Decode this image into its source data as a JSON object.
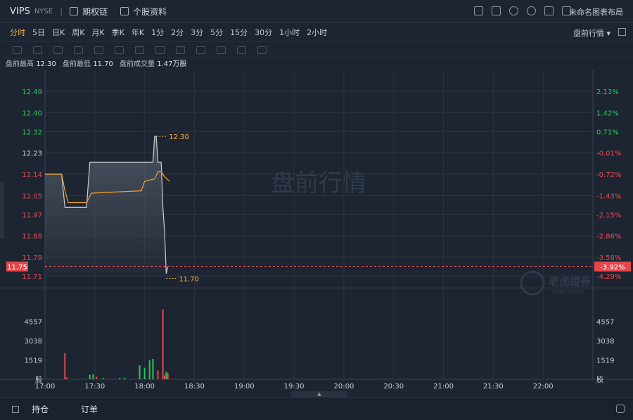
{
  "header": {
    "symbol": "VIPS",
    "exchange": "NYSE",
    "options_chain": "期权链",
    "stock_profile": "个股资料",
    "layout_name": "未命名图表布局",
    "icons": [
      "screen-icon",
      "edit-icon",
      "refresh-icon",
      "settings-icon",
      "fullscreen-icon",
      "grid-icon"
    ]
  },
  "period_tabs": [
    "分时",
    "5日",
    "日K",
    "周K",
    "月K",
    "季K",
    "年K",
    "1分",
    "2分",
    "3分",
    "5分",
    "15分",
    "30分",
    "1小时",
    "2小时"
  ],
  "active_tab": "分时",
  "premarket_mode": "盘前行情",
  "info": {
    "high_label": "盘前最高",
    "high_value": "12.30",
    "low_label": "盘前最低",
    "low_value": "11.70",
    "volume_label": "盘前成交量",
    "volume_value": "1.47万股"
  },
  "watermark": "盘前行情",
  "brand_watermark": "老虎證券",
  "brand_watermark_en": "TIGER TRADE",
  "bottom_tabs": [
    "持仓",
    "订单"
  ],
  "colors": {
    "up": "#e4474c",
    "down": "#2fc25b",
    "price_line": "#c8ccd4",
    "avg_line": "#f0a32e",
    "accent": "#f2b33d"
  },
  "chart_data": {
    "type": "line",
    "x_ticks": [
      "17:00",
      "17:30",
      "18:00",
      "18:30",
      "19:00",
      "19:30",
      "20:00",
      "20:30",
      "21:00",
      "21:30",
      "22:00"
    ],
    "y_ticks": [
      "12.49",
      "12.40",
      "12.32",
      "12.23",
      "12.14",
      "12.05",
      "11.97",
      "11.88",
      "11.79",
      "11.71"
    ],
    "pct_ticks": [
      "2.13%",
      "1.42%",
      "0.71%",
      "-0.01%",
      "-0.72%",
      "-1.43%",
      "-2.15%",
      "-2.86%",
      "-3.58%",
      "-4.29%"
    ],
    "ylim": [
      11.71,
      12.49
    ],
    "reference_price": 12.23,
    "current_price": "11.75",
    "current_pct": "-3.92%",
    "high_marker": "12.30",
    "low_marker": "11.70",
    "price_series": [
      [
        "17:00",
        12.14
      ],
      [
        "17:10",
        12.14
      ],
      [
        "17:12",
        12.0
      ],
      [
        "17:25",
        12.0
      ],
      [
        "17:27",
        12.19
      ],
      [
        "17:58",
        12.19
      ],
      [
        "18:00",
        12.19
      ],
      [
        "18:03",
        12.19
      ],
      [
        "18:05",
        12.19
      ],
      [
        "18:06",
        12.3
      ],
      [
        "18:07",
        12.3
      ],
      [
        "18:08",
        12.19
      ],
      [
        "18:10",
        12.19
      ],
      [
        "18:11",
        12.0
      ],
      [
        "18:12",
        11.9
      ],
      [
        "18:13",
        11.72
      ],
      [
        "18:14",
        11.75
      ]
    ],
    "avg_series": [
      [
        "17:00",
        12.14
      ],
      [
        "17:10",
        12.14
      ],
      [
        "17:12",
        12.07
      ],
      [
        "17:14",
        12.02
      ],
      [
        "17:25",
        12.02
      ],
      [
        "17:28",
        12.06
      ],
      [
        "17:58",
        12.07
      ],
      [
        "18:00",
        12.11
      ],
      [
        "18:06",
        12.12
      ],
      [
        "18:08",
        12.15
      ],
      [
        "18:10",
        12.15
      ],
      [
        "18:12",
        12.13
      ],
      [
        "18:15",
        12.11
      ]
    ],
    "volume_ticks": [
      "4557",
      "3038",
      "1519",
      "股"
    ],
    "volume_max": 6076,
    "volume_bars": [
      [
        "17:12",
        2050,
        "up"
      ],
      [
        "17:13",
        150,
        "up"
      ],
      [
        "17:27",
        350,
        "down"
      ],
      [
        "17:29",
        400,
        "down"
      ],
      [
        "17:31",
        200,
        "up"
      ],
      [
        "17:35",
        100,
        "down"
      ],
      [
        "17:45",
        100,
        "down"
      ],
      [
        "17:48",
        120,
        "down"
      ],
      [
        "17:57",
        1100,
        "down"
      ],
      [
        "18:00",
        900,
        "down"
      ],
      [
        "18:03",
        1500,
        "down"
      ],
      [
        "18:05",
        1600,
        "down"
      ],
      [
        "18:08",
        700,
        "up"
      ],
      [
        "18:11",
        5500,
        "up"
      ],
      [
        "18:12",
        300,
        "up"
      ],
      [
        "18:13",
        600,
        "down"
      ],
      [
        "18:14",
        500,
        "up"
      ]
    ]
  }
}
